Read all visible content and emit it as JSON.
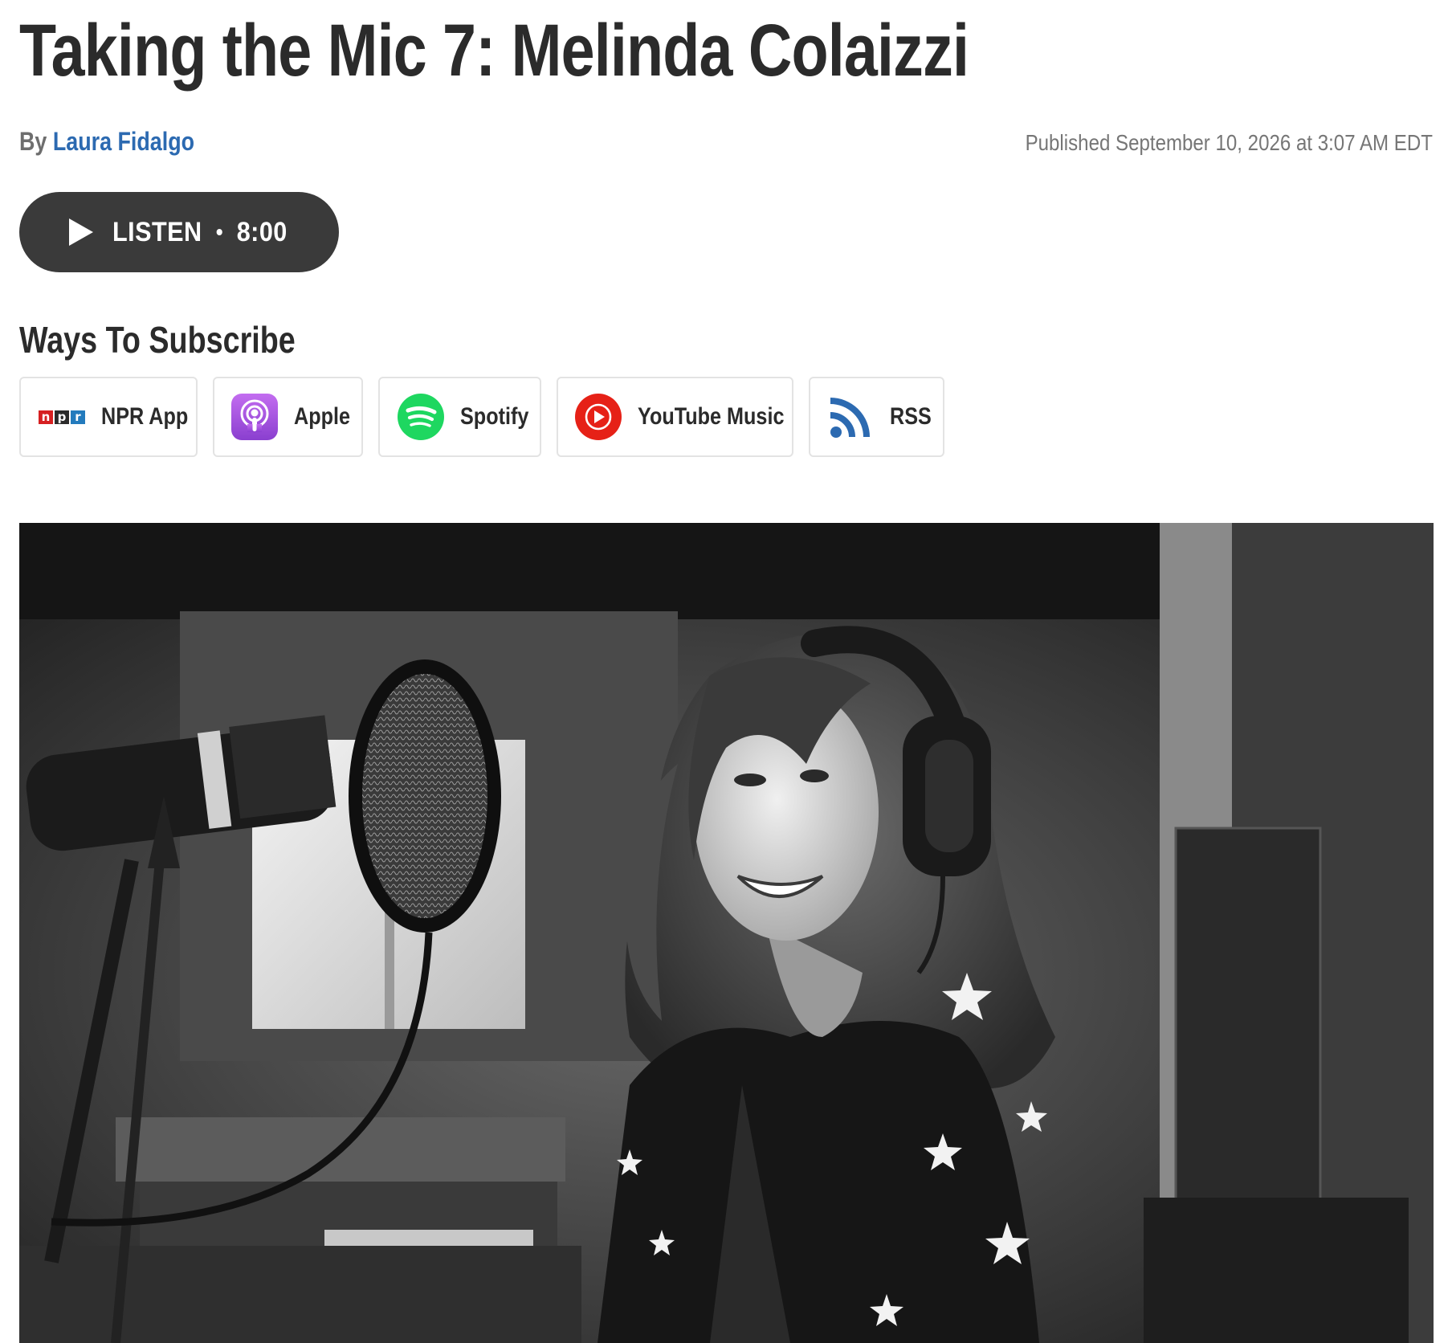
{
  "article": {
    "title": "Taking the Mic 7: Melinda Colaizzi",
    "byline_prefix": "By",
    "author": "Laura Fidalgo",
    "published": "Published September 10, 2026 at 3:07 AM EDT"
  },
  "player": {
    "listen_label": "LISTEN",
    "duration": "8:00",
    "icon": "play-icon"
  },
  "subscribe": {
    "heading": "Ways To Subscribe",
    "options": [
      {
        "label": "NPR App",
        "icon": "npr-logo-icon",
        "logo_letters": [
          "n",
          "p",
          "r"
        ]
      },
      {
        "label": "Apple",
        "icon": "apple-podcasts-icon"
      },
      {
        "label": "Spotify",
        "icon": "spotify-icon"
      },
      {
        "label": "YouTube Music",
        "icon": "youtube-music-icon"
      },
      {
        "label": "RSS",
        "icon": "rss-icon"
      }
    ]
  },
  "colors": {
    "title": "#2b2b2b",
    "author_link": "#2c6ab1",
    "listen_button": "#3a3a3a",
    "apple": "#9b51d8",
    "spotify": "#1ed760",
    "youtube_music": "#e62117",
    "rss": "#2c6ab1"
  }
}
